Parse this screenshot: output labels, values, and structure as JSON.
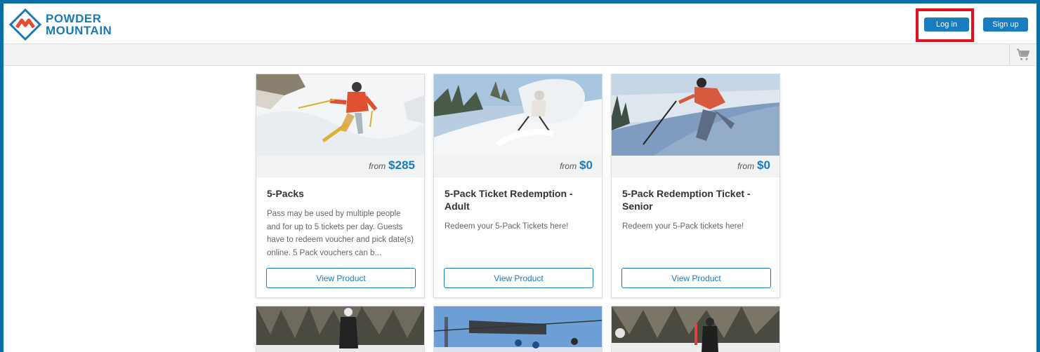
{
  "brand": {
    "line1": "POWDER",
    "line2": "MOUNTAIN",
    "accent": "#1b79b8",
    "mark_color": "#e44b2f"
  },
  "header": {
    "login_label": "Log in",
    "signup_label": "Sign up"
  },
  "colors": {
    "primary": "#1a7cc0",
    "highlight": "#e3101d"
  },
  "cards": [
    {
      "from": "from",
      "price": "$285",
      "title": "5-Packs",
      "description": "Pass may be used by multiple people and for up to 5 tickets per day. Guests have to redeem voucher and pick date(s) online. 5 Pack vouchers can b...",
      "button": "View Product"
    },
    {
      "from": "from",
      "price": "$0",
      "title": "5-Pack Ticket Redemption - Adult",
      "description": "Redeem your 5-Pack Tickets here!",
      "button": "View Product"
    },
    {
      "from": "from",
      "price": "$0",
      "title": "5-Pack Redemption Ticket - Senior",
      "description": "Redeem your 5-Pack tickets here!",
      "button": "View Product"
    }
  ]
}
